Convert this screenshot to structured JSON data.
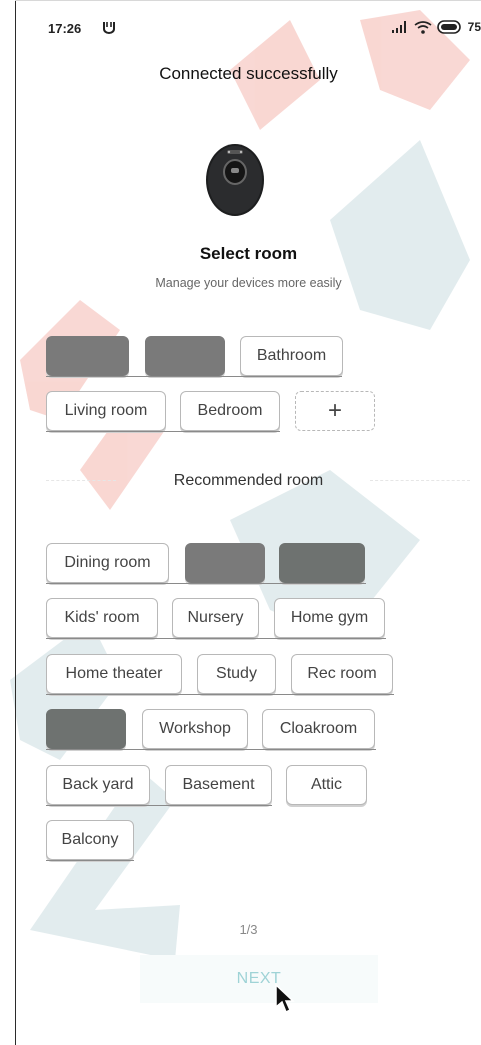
{
  "status_bar": {
    "time": "17:26",
    "battery_level": "75",
    "icons": [
      "app-notification-icon",
      "signal-icon",
      "wifi-icon",
      "battery-icon"
    ]
  },
  "header": {
    "title": "Connected successfully"
  },
  "select_room": {
    "heading": "Select room",
    "subheading": "Manage your devices more easily",
    "rooms": [
      {
        "label": ""
      },
      {
        "label": ""
      },
      {
        "label": "Bathroom"
      },
      {
        "label": "Living room"
      },
      {
        "label": "Bedroom"
      }
    ],
    "add_label": "+"
  },
  "recommended": {
    "title": "Recommended room",
    "rooms": [
      {
        "label": "Dining room"
      },
      {
        "label": ""
      },
      {
        "label": ""
      },
      {
        "label": "Kids' room"
      },
      {
        "label": "Nursery"
      },
      {
        "label": "Home gym"
      },
      {
        "label": "Home theater"
      },
      {
        "label": "Study"
      },
      {
        "label": "Rec room"
      },
      {
        "label": ""
      },
      {
        "label": "Workshop"
      },
      {
        "label": "Cloakroom"
      },
      {
        "label": "Back yard"
      },
      {
        "label": "Basement"
      },
      {
        "label": "Attic"
      },
      {
        "label": "Balcony"
      }
    ]
  },
  "footer": {
    "pager": "1/3",
    "next_label": "NEXT"
  },
  "colors": {
    "next_text": "#9fd3d6",
    "chip_filled": "#7a7a7a"
  }
}
